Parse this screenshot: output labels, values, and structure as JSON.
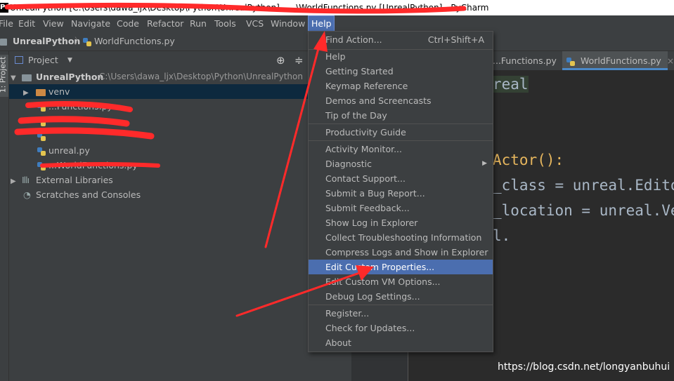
{
  "window": {
    "title": "UnrealPython [C:\\Users\\dawa_ljx\\Desktop\\Python\\UnrealPython] - ...\\WorldFunctions.py [UnrealPython] - PyCharm",
    "app_icon": "PC"
  },
  "menubar": [
    "File",
    "Edit",
    "View",
    "Navigate",
    "Code",
    "Refactor",
    "Run",
    "Tools",
    "VCS",
    "Window",
    "Help"
  ],
  "navbar": {
    "project": "UnrealPython",
    "file": "WorldFunctions.py"
  },
  "toolstrip": {
    "project_tab": "1: Project"
  },
  "project_panel": {
    "header": "Project",
    "root": {
      "name": "UnrealPython",
      "path": "C:\\Users\\dawa_ljx\\Desktop\\Python\\UnrealPython"
    },
    "items": [
      "venv",
      "...Functions.py",
      "",
      "",
      "unreal.py",
      "...WorldFunctions.py",
      "External Libraries",
      "Scratches and Consoles"
    ]
  },
  "editor": {
    "tabs": [
      "...Functions.py",
      "WorldFunctions.py"
    ],
    "lines": [
      "real",
      "Actor():",
      "_class = unreal.Editor",
      "_location = unreal.Vec",
      "l."
    ]
  },
  "help_menu": {
    "items": [
      {
        "label": "Find Action...",
        "shortcut": "Ctrl+Shift+A"
      },
      {
        "label": "Help"
      },
      {
        "label": "Getting Started"
      },
      {
        "label": "Keymap Reference"
      },
      {
        "label": "Demos and Screencasts"
      },
      {
        "label": "Tip of the Day"
      },
      {
        "label": "Productivity Guide"
      },
      {
        "label": "Activity Monitor..."
      },
      {
        "label": "Diagnostic"
      },
      {
        "label": "Contact Support..."
      },
      {
        "label": "Submit a Bug Report..."
      },
      {
        "label": "Submit Feedback..."
      },
      {
        "label": "Show Log in Explorer"
      },
      {
        "label": "Collect Troubleshooting Information"
      },
      {
        "label": "Compress Logs and Show in Explorer"
      },
      {
        "label": "Edit Custom Properties..."
      },
      {
        "label": "Edit Custom VM Options..."
      },
      {
        "label": "Debug Log Settings..."
      },
      {
        "label": "Register..."
      },
      {
        "label": "Check for Updates..."
      },
      {
        "label": "About"
      }
    ]
  },
  "watermark": "https://blog.csdn.net/longyanbuhui",
  "colors": {
    "accent": "#4b6eaf",
    "annotation": "#ff2a2a",
    "folder": "#cc8844"
  }
}
